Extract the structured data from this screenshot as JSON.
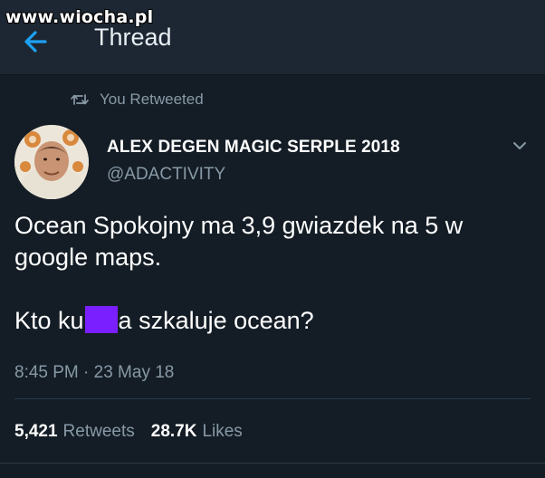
{
  "watermark": "www.wiocha.pl",
  "header": {
    "title": "Thread",
    "back_icon": "arrow-left-icon"
  },
  "retweet_context": {
    "icon": "retweet-icon",
    "label": "You Retweeted"
  },
  "tweet": {
    "author_name": "ALEX DEGEN MAGIC SERPLE 2018",
    "author_handle": "@ADACTIVITY",
    "menu_icon": "chevron-down-icon",
    "text_line1": "Ocean Spokojny ma 3,9 gwiazdek na 5 w google maps.",
    "text_line2_before": "Kto ku",
    "text_line2_after": "a szkaluje ocean?",
    "censor_color": "#7a1fff",
    "timestamp": "8:45 PM · 23 May 18",
    "retweets_count": "5,421",
    "retweets_label": "Retweets",
    "likes_count": "28.7K",
    "likes_label": "Likes"
  },
  "colors": {
    "background": "#141d26",
    "header_bg": "#1c2733",
    "accent": "#1da1f2",
    "secondary_text": "#8899a6"
  }
}
